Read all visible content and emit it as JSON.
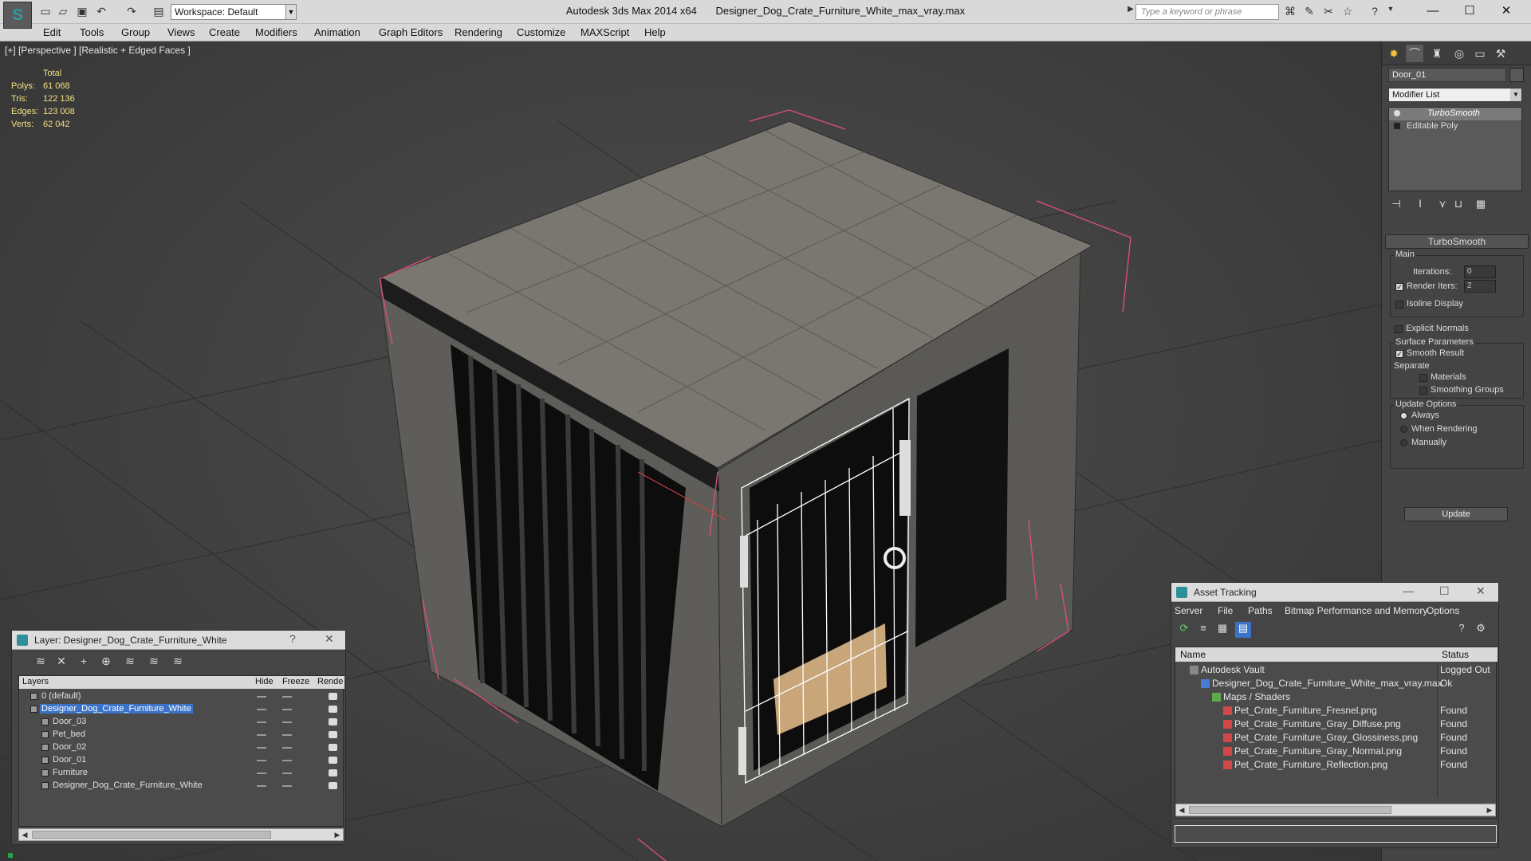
{
  "titlebar": {
    "workspace_label": "Workspace: Default",
    "app_name": "Autodesk 3ds Max  2014 x64",
    "file_name": "Designer_Dog_Crate_Furniture_White_max_vray.max",
    "search_placeholder": "Type a keyword or phrase"
  },
  "menu": [
    "Edit",
    "Tools",
    "Group",
    "Views",
    "Create",
    "Modifiers",
    "Animation",
    "Graph Editors",
    "Rendering",
    "Customize",
    "MAXScript",
    "Help"
  ],
  "viewport": {
    "label": "[+] [Perspective ] [Realistic + Edged Faces ]",
    "stats_header": "Total",
    "stats": [
      {
        "k": "Polys:",
        "v": "61 068"
      },
      {
        "k": "Tris:",
        "v": "122 136"
      },
      {
        "k": "Edges:",
        "v": "123 008"
      },
      {
        "k": "Verts:",
        "v": "62 042"
      }
    ]
  },
  "command_panel": {
    "object_name": "Door_01",
    "modifier_list": "Modifier List",
    "stack": [
      "TurboSmooth",
      "Editable Poly"
    ],
    "rollout_title": "TurboSmooth",
    "main_group": "Main",
    "iterations_label": "Iterations:",
    "iterations_value": "0",
    "render_iters_label": "Render Iters:",
    "render_iters_value": "2",
    "isoline_label": "Isoline Display",
    "explicit_normals_label": "Explicit Normals",
    "surface_group": "Surface Parameters",
    "smooth_result_label": "Smooth Result",
    "separate_label": "Separate",
    "materials_label": "Materials",
    "smoothing_groups_label": "Smoothing Groups",
    "update_group": "Update Options",
    "always_label": "Always",
    "when_rendering_label": "When Rendering",
    "manually_label": "Manually",
    "update_button": "Update"
  },
  "layer_window": {
    "title": "Layer: Designer_Dog_Crate_Furniture_White",
    "columns": [
      "Layers",
      "Hide",
      "Freeze",
      "Rende"
    ],
    "rows": [
      {
        "name": "0 (default)",
        "indent": 1,
        "selected": false
      },
      {
        "name": "Designer_Dog_Crate_Furniture_White",
        "indent": 1,
        "selected": true
      },
      {
        "name": "Door_03",
        "indent": 2,
        "selected": false
      },
      {
        "name": "Pet_bed",
        "indent": 2,
        "selected": false
      },
      {
        "name": "Door_02",
        "indent": 2,
        "selected": false
      },
      {
        "name": "Door_01",
        "indent": 2,
        "selected": false
      },
      {
        "name": "Furniture",
        "indent": 2,
        "selected": false
      },
      {
        "name": "Designer_Dog_Crate_Furniture_White",
        "indent": 2,
        "selected": false
      }
    ]
  },
  "asset_window": {
    "title": "Asset Tracking",
    "menu": [
      "Server",
      "File",
      "Paths",
      "Bitmap Performance and Memory",
      "Options"
    ],
    "col_name": "Name",
    "col_status": "Status",
    "rows": [
      {
        "name": "Autodesk Vault",
        "status": "Logged Out",
        "indent": 0
      },
      {
        "name": "Designer_Dog_Crate_Furniture_White_max_vray.max",
        "status": "Ok",
        "indent": 1
      },
      {
        "name": "Maps / Shaders",
        "status": "",
        "indent": 2
      },
      {
        "name": "Pet_Crate_Furniture_Fresnel.png",
        "status": "Found",
        "indent": 3
      },
      {
        "name": "Pet_Crate_Furniture_Gray_Diffuse.png",
        "status": "Found",
        "indent": 3
      },
      {
        "name": "Pet_Crate_Furniture_Gray_Glossiness.png",
        "status": "Found",
        "indent": 3
      },
      {
        "name": "Pet_Crate_Furniture_Gray_Normal.png",
        "status": "Found",
        "indent": 3
      },
      {
        "name": "Pet_Crate_Furniture_Reflection.png",
        "status": "Found",
        "indent": 3
      }
    ]
  },
  "colors": {
    "selection": "#3a73c8",
    "stats_text": "#f0e080",
    "bounding_box": "#e0507a",
    "app_accent": "#2e8f9a"
  }
}
